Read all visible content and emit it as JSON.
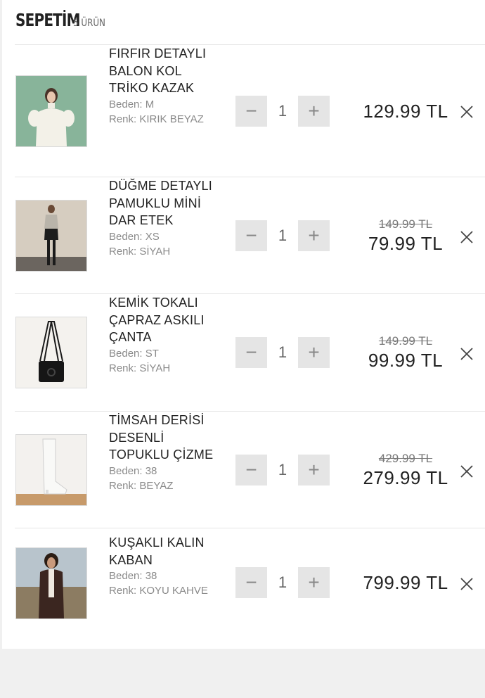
{
  "cart": {
    "title": "SEPETİM",
    "count_label": "5 ÜRÜN"
  },
  "labels": {
    "size": "Beden:",
    "color": "Renk:"
  },
  "icons": {
    "minus": "minus-icon",
    "plus": "plus-icon",
    "remove": "close-icon"
  },
  "items": [
    {
      "name": "FIRFIR DETAYLI BALON KOL TRİKO KAZAK",
      "size": "Beden: M",
      "color": "Renk: KIRIK BEYAZ",
      "quantity": "1",
      "old_price": "",
      "price": "129.99 TL",
      "image": "model-white-knit-sweater-photo"
    },
    {
      "name": "DÜĞME DETAYLI PAMUKLU MİNİ DAR ETEK",
      "size": "Beden: XS",
      "color": "Renk: SİYAH",
      "quantity": "1",
      "old_price": "149.99 TL",
      "price": "79.99 TL",
      "image": "model-black-mini-skirt-photo"
    },
    {
      "name": "KEMİK TOKALI ÇAPRAZ ASKILI ÇANTA",
      "size": "Beden: ST",
      "color": "Renk: SİYAH",
      "quantity": "1",
      "old_price": "149.99 TL",
      "price": "99.99 TL",
      "image": "black-crossbody-bag-photo"
    },
    {
      "name": "TİMSAH DERİSİ DESENLİ TOPUKLU ÇİZME",
      "size": "Beden: 38",
      "color": "Renk: BEYAZ",
      "quantity": "1",
      "old_price": "429.99 TL",
      "price": "279.99 TL",
      "image": "white-heeled-boot-photo"
    },
    {
      "name": "KUŞAKLI KALIN KABAN",
      "size": "Beden: 38",
      "color": "Renk: KOYU KAHVE",
      "quantity": "1",
      "old_price": "",
      "price": "799.99 TL",
      "image": "model-dark-brown-coat-photo"
    }
  ],
  "colors": {
    "background": "#f0f0f0",
    "panel": "#ffffff",
    "qty_button": "#e5e5e5",
    "text": "#222222",
    "muted": "#8a8a8a"
  }
}
